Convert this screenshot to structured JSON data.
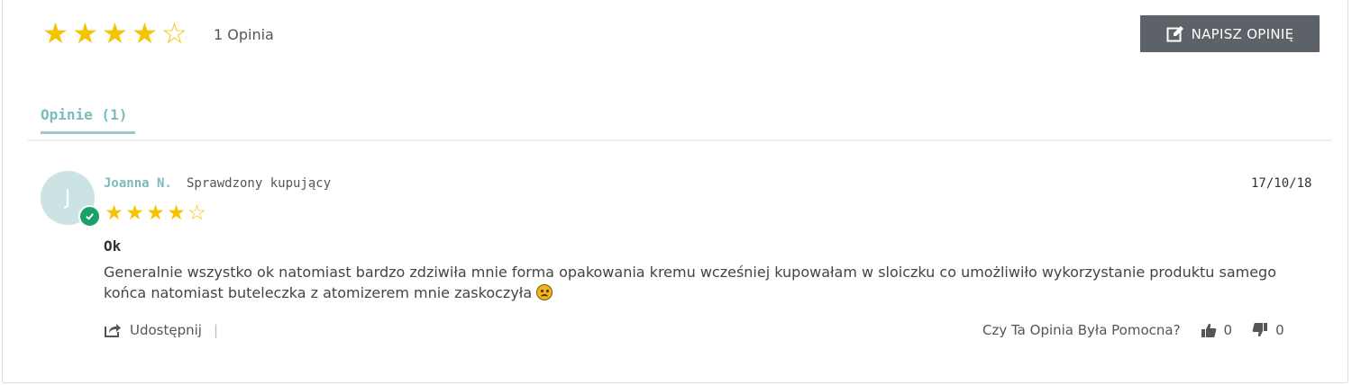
{
  "summary": {
    "rating": 4,
    "max_rating": 5,
    "stars": [
      "★",
      "★",
      "★",
      "★",
      "☆"
    ],
    "count_label": "1 Opinia"
  },
  "toolbar": {
    "write_review_label": "NAPISZ OPINIĘ"
  },
  "tabs": [
    {
      "label": "Opinie (1)",
      "active": true
    }
  ],
  "review": {
    "avatar_initial": "J",
    "reviewer_name": "Joanna N.",
    "verified_label": "Sprawdzony kupujący",
    "rating": 4,
    "stars": [
      "★",
      "★",
      "★",
      "★",
      "☆"
    ],
    "date": "17/10/18",
    "title": "Ok",
    "body": "Generalnie wszystko ok natomiast bardzo zdziwiła mnie forma opakowania kremu wcześniej kupowałam w sloiczku co umożliwiło wykorzystanie produktu samego końca natomiast buteleczka z atomizerem mnie zaskoczyła",
    "share_label": "Udostępnij",
    "share_separator": "|",
    "helpful_question": "Czy Ta Opinia Była Pomocna?",
    "votes_up": "0",
    "votes_down": "0"
  },
  "colors": {
    "star": "#f5c400",
    "accent": "#7dbbbb",
    "button_bg": "#5d6168",
    "verified_badge": "#1ca06b"
  }
}
